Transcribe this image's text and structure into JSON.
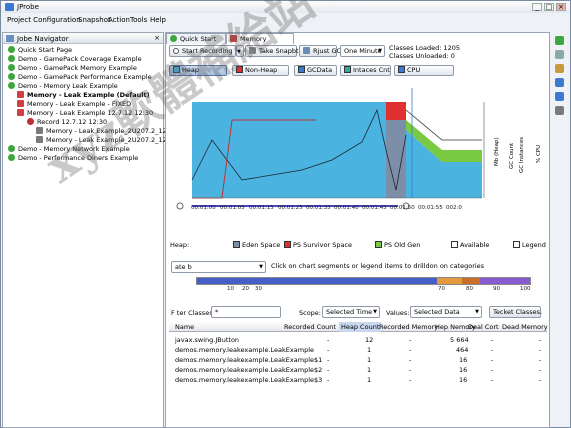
{
  "window": {
    "title": "JProbe",
    "controls": [
      "_",
      "□",
      "×"
    ]
  },
  "menu": [
    "Project Configuration",
    "Snapshot",
    "Action",
    "Tools",
    "Help"
  ],
  "navigator": {
    "title": "Jobe Navigator",
    "items": [
      {
        "label": "Quick Start Page"
      },
      {
        "label": "Demo - GamePack Coverage Example"
      },
      {
        "label": "Demo - GamePack Memory Example"
      },
      {
        "label": "Demo - GamePack Performance Example"
      },
      {
        "label": "Demo - Memory Leak Example"
      },
      {
        "label": "Memory - Leak Example (Default)"
      },
      {
        "label": "Memory - Leak Example - FIXED"
      },
      {
        "label": "Memory - Leak Example 12.7.12 12:30"
      },
      {
        "label": "Record 12.7.12 12:30"
      },
      {
        "label": "Memory - Leak Example_2U207.2_122("
      },
      {
        "label": "Memory - Leak Example_2U207.2_123("
      },
      {
        "label": "Demo - Memory Network Example"
      },
      {
        "label": "Demo - Performance Diners Example"
      }
    ]
  },
  "tabs": [
    {
      "label": "Quick Start Page"
    },
    {
      "label": "Memory Session"
    }
  ],
  "toolbar": {
    "start_recording": "Start Recording",
    "take_snapshot": "Take Snapbt",
    "run_gc": "Rjust GC",
    "interval": "One Minute",
    "classes_loaded": "Classes Loaded: 1205",
    "classes_unloaded": "Classes Unloaded: 0"
  },
  "view_buttons": [
    {
      "label": "Heap",
      "pressed": true
    },
    {
      "label": "Non-Heap",
      "pressed": false
    },
    {
      "label": "GCData",
      "pressed": false
    },
    {
      "label": "Intaces Cnt",
      "pressed": false
    },
    {
      "label": "CPU",
      "pressed": false
    }
  ],
  "chart_data": {
    "type": "area",
    "x_ticks": [
      "00:01:00",
      "00:01:05",
      "00:01:15",
      "00:01:25",
      "00:01:35",
      "00:01:40",
      "00:01:45",
      "00:01:50",
      "00:01:55",
      "002:0"
    ],
    "right_axes": [
      "Mb (Heap)",
      "GC Count",
      "GC Instances",
      "% CPU"
    ],
    "colors": {
      "heap": "#4ab3e0",
      "old_gen": "#7ac943",
      "survivor": "#e03030",
      "eden": "#7d8fa8"
    }
  },
  "legend": {
    "heap_label": "Heap:",
    "eden": "Eden Space",
    "survivor": "PS Survivor Space",
    "old_gen": "PS Old Gen",
    "available": "Available",
    "legend_toggle": "Legend"
  },
  "drill": {
    "select_label": "ate b",
    "hint": "Click on chart segments or legend items to drilldon on categories",
    "scale": [
      "10",
      "20",
      "30",
      "70",
      "80",
      "90",
      "100"
    ]
  },
  "filter": {
    "label": "F ter Classes:",
    "value": "*",
    "scope_label": "Scope:",
    "scope_value": "Selected Time",
    "values_label": "Values:",
    "values_value": "Selected Data",
    "track_button": "Tecket Classes."
  },
  "table": {
    "columns": [
      "Name",
      "Recorded Count",
      "Heap Count",
      "Recorded Memory",
      "Hep Nemory",
      "Deal Cort",
      "Dead Memory"
    ],
    "rows": [
      {
        "name": "javax.swing.JButton",
        "rc": "-",
        "hc": "12",
        "rm": "-",
        "hm": "5 664",
        "dc": "-",
        "dm": "-"
      },
      {
        "name": "demos.memory.leakexample.LeakExample",
        "rc": "-",
        "hc": "1",
        "rm": "-",
        "hm": "464",
        "dc": "-",
        "dm": "-"
      },
      {
        "name": "demos.memory.leakexample.LeakExample$1",
        "rc": "-",
        "hc": "1",
        "rm": "-",
        "hm": "16",
        "dc": "-",
        "dm": "-"
      },
      {
        "name": "demos.memory.leakexample.LeakExample$2",
        "rc": "-",
        "hc": "1",
        "rm": "-",
        "hm": "16",
        "dc": "-",
        "dm": "-"
      },
      {
        "name": "demos.memory.leakexample.LeakExample$3",
        "rc": "-",
        "hc": "1",
        "rm": "-",
        "hm": "16",
        "dc": "-",
        "dm": "-"
      }
    ]
  },
  "watermark": "xyz軟體補給站 http://31.to"
}
